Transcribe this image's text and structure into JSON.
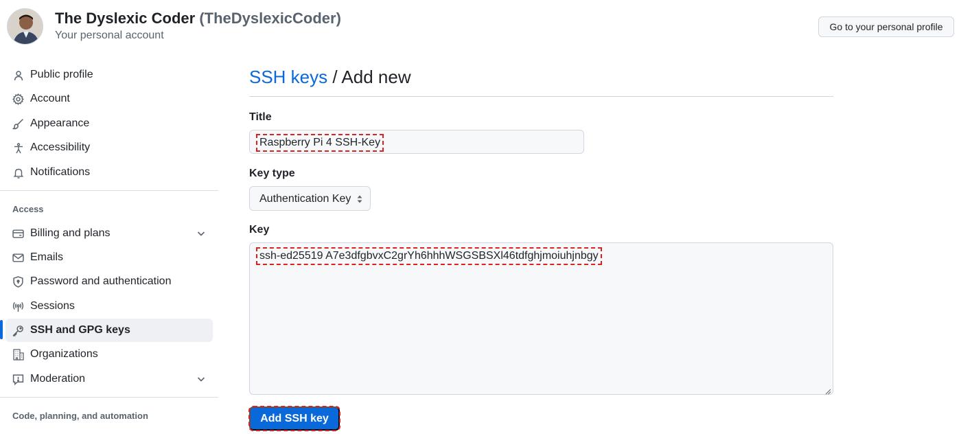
{
  "header": {
    "account_name": "The Dyslexic Coder",
    "account_handle": "(TheDyslexicCoder)",
    "account_subtitle": "Your personal account",
    "profile_button_label": "Go to your personal profile"
  },
  "sidebar": {
    "items_top": [
      {
        "label": "Public profile",
        "icon": "person-icon"
      },
      {
        "label": "Account",
        "icon": "gear-icon"
      },
      {
        "label": "Appearance",
        "icon": "paintbrush-icon"
      },
      {
        "label": "Accessibility",
        "icon": "accessibility-icon"
      },
      {
        "label": "Notifications",
        "icon": "bell-icon"
      }
    ],
    "access_label": "Access",
    "items_access": [
      {
        "label": "Billing and plans",
        "icon": "credit-card-icon",
        "expandable": true
      },
      {
        "label": "Emails",
        "icon": "mail-icon"
      },
      {
        "label": "Password and authentication",
        "icon": "shield-lock-icon"
      },
      {
        "label": "Sessions",
        "icon": "broadcast-icon"
      },
      {
        "label": "SSH and GPG keys",
        "icon": "key-icon",
        "active": true
      },
      {
        "label": "Organizations",
        "icon": "organization-icon"
      },
      {
        "label": "Moderation",
        "icon": "report-icon",
        "expandable": true
      }
    ],
    "code_label": "Code, planning, and automation"
  },
  "main": {
    "breadcrumb_link": "SSH keys",
    "breadcrumb_sep": "/",
    "breadcrumb_current": "Add new",
    "title_label": "Title",
    "title_value": "Raspberry Pi 4 SSH-Key",
    "key_type_label": "Key type",
    "key_type_value": "Authentication Key",
    "key_label": "Key",
    "key_value": "ssh-ed25519 A7e3dfgbvxC2grYh6hhhWSGSBSXl46tdfghjmoiuhjnbgy",
    "submit_label": "Add SSH key"
  },
  "colors": {
    "accent": "#0969da",
    "annotation": "#e0201f",
    "active_bg": "#eef0f3"
  }
}
